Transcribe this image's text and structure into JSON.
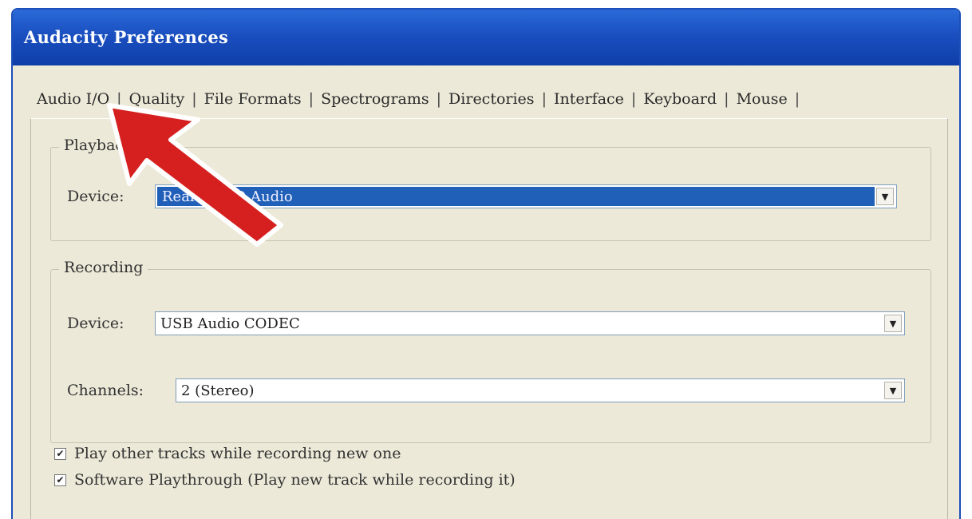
{
  "window": {
    "title": "Audacity Preferences"
  },
  "tabs": [
    {
      "label": "Audio I/O",
      "active": true
    },
    {
      "label": "Quality"
    },
    {
      "label": "File Formats"
    },
    {
      "label": "Spectrograms"
    },
    {
      "label": "Directories"
    },
    {
      "label": "Interface"
    },
    {
      "label": "Keyboard"
    },
    {
      "label": "Mouse"
    }
  ],
  "playback": {
    "group_label": "Playback",
    "device_label": "Device:",
    "device_value": "Realtek HD Audio"
  },
  "recording": {
    "group_label": "Recording",
    "device_label": "Device:",
    "device_value": "USB Audio CODEC",
    "channels_label": "Channels:",
    "channels_value": "2 (Stereo)"
  },
  "options": [
    {
      "label": "Play other tracks while recording new one",
      "checked": true
    },
    {
      "label": "Software Playthrough (Play new track while recording it)",
      "checked": true
    }
  ],
  "colors": {
    "titlebar": "#1a4fc0",
    "selection": "#2160b8",
    "arrow": "#d62020"
  },
  "icons": {
    "dropdown": "chevron-down-icon",
    "annotation": "arrow-icon"
  }
}
